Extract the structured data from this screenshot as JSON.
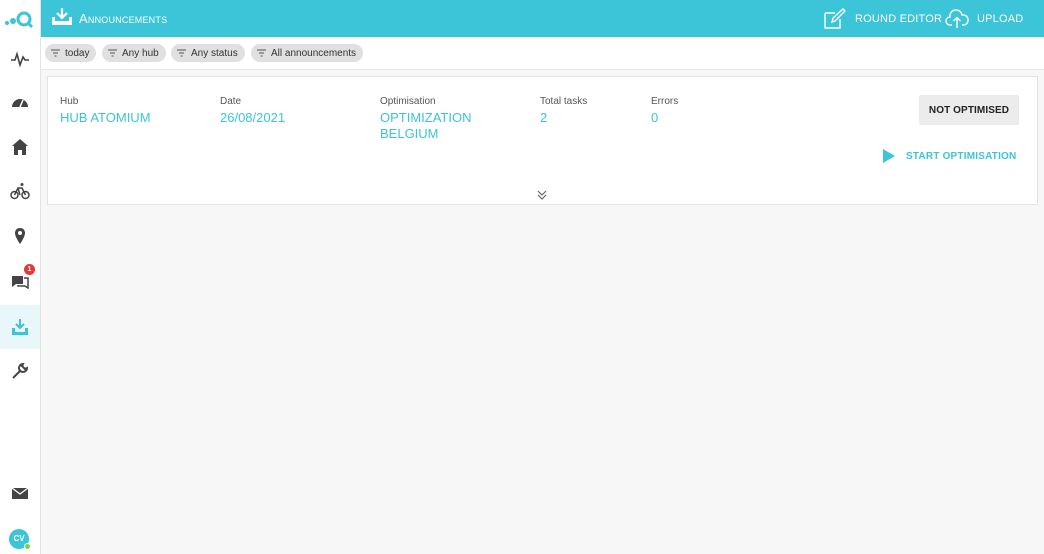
{
  "brand": {
    "accent": "#3cc4d8",
    "badge_color": "#e53935",
    "online_color": "#7bd34b"
  },
  "sidebar": {
    "items": [
      {
        "name": "activity",
        "icon": "pulse-icon"
      },
      {
        "name": "dashboard",
        "icon": "speedometer-icon"
      },
      {
        "name": "hubs",
        "icon": "home-icon"
      },
      {
        "name": "couriers",
        "icon": "bike-icon"
      },
      {
        "name": "locations",
        "icon": "map-pin-icon"
      },
      {
        "name": "messages",
        "icon": "chat-icon",
        "badge": "1"
      },
      {
        "name": "announcements",
        "icon": "tray-download-icon",
        "active": true
      },
      {
        "name": "settings",
        "icon": "wrench-icon"
      }
    ],
    "mail_icon": "mail-icon",
    "avatar_initials": "CV"
  },
  "header": {
    "title": "Announcements",
    "round_editor_label": "ROUND EDITOR",
    "upload_label": "UPLOAD"
  },
  "filters": [
    {
      "label": "today"
    },
    {
      "label": "Any hub"
    },
    {
      "label": "Any status"
    },
    {
      "label": "All announcements"
    }
  ],
  "announcement": {
    "hub_label": "Hub",
    "hub_value": "HUB ATOMIUM",
    "date_label": "Date",
    "date_value": "26/08/2021",
    "optimisation_label": "Optimisation",
    "optimisation_value_line1": "OPTIMIZATION",
    "optimisation_value_line2": "BELGIUM",
    "total_tasks_label": "Total tasks",
    "total_tasks_value": "2",
    "errors_label": "Errors",
    "errors_value": "0",
    "status_label": "NOT OPTIMISED",
    "start_label": "START OPTIMISATION"
  }
}
